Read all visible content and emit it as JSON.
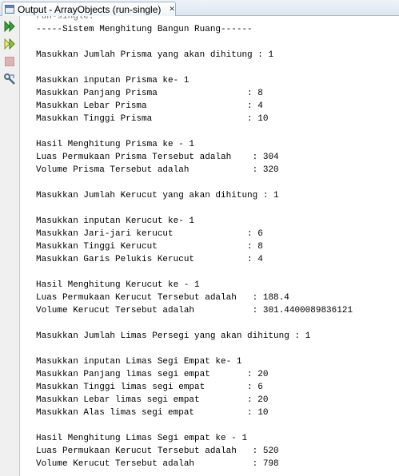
{
  "tab": {
    "title": "Output - ArrayObjects (run-single)",
    "close_glyph": "✕"
  },
  "sidebar": {
    "icons": [
      "rerun-icon",
      "rerun-with-args-icon",
      "stop-icon",
      "settings-wrench-icon"
    ]
  },
  "console": {
    "lines": [
      "run-single:",
      "-----Sistem Menghitung Bangun Ruang------",
      "",
      "Masukkan Jumlah Prisma yang akan dihitung : 1",
      "",
      "Masukkan inputan Prisma ke- 1",
      "Masukkan Panjang Prisma                 : 8",
      "Masukkan Lebar Prisma                   : 4",
      "Masukkan Tinggi Prisma                  : 10",
      "",
      "Hasil Menghitung Prisma ke - 1",
      "Luas Permukaan Prisma Tersebut adalah    : 304",
      "Volume Prisma Tersebut adalah            : 320",
      "",
      "Masukkan Jumlah Kerucut yang akan dihitung : 1",
      "",
      "Masukkan inputan Kerucut ke- 1",
      "Masukkan Jari-jari kerucut              : 6",
      "Masukkan Tinggi Kerucut                 : 8",
      "Masukkan Garis Pelukis Kerucut          : 4",
      "",
      "Hasil Menghitung Kerucut ke - 1",
      "Luas Permukaan Kerucut Tersebut adalah   : 188.4",
      "Volume Kerucut Tersebut adalah           : 301.4400089836121",
      "",
      "Masukkan Jumlah Limas Persegi yang akan dihitung : 1",
      "",
      "Masukkan inputan Limas Segi Empat ke- 1",
      "Masukkan Panjang limas segi empat       : 20",
      "Masukkan Tinggi limas segi empat        : 6",
      "Masukkan Lebar limas segi empat         : 20",
      "Masukkan Alas limas segi empat          : 10",
      "",
      "Hasil Menghitung Limas Segi empat ke - 1",
      "Luas Permukaan Kerucut Tersebut adalah   : 520",
      "Volume Kerucut Tersebut adalah           : 798"
    ]
  },
  "colors": {
    "run_icon": "#3aa13a",
    "stop_icon": "#d8b4b4",
    "text": "#000000"
  }
}
